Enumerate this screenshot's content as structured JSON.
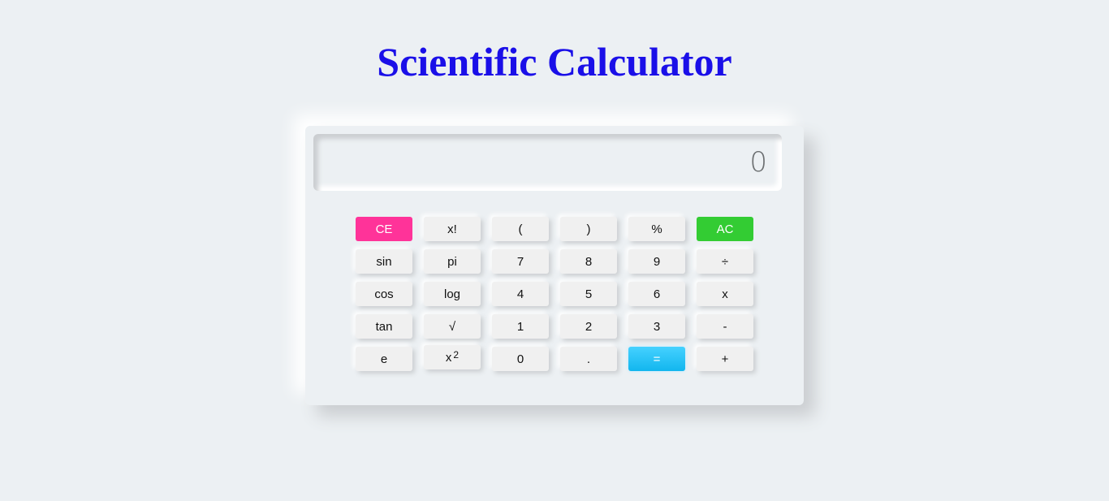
{
  "page": {
    "title": "Scientific Calculator"
  },
  "display": {
    "value": "0"
  },
  "colors": {
    "title": "#1a0fe8",
    "ce": "#ff3399",
    "ac": "#33cc33",
    "equals": "#1ec0f5",
    "background": "#ecf0f3"
  },
  "keys": {
    "ce": "CE",
    "factorial": "x!",
    "open_paren": "(",
    "close_paren": ")",
    "percent": "%",
    "ac": "AC",
    "sin": "sin",
    "pi": "pi",
    "seven": "7",
    "eight": "8",
    "nine": "9",
    "divide": "÷",
    "cos": "cos",
    "log": "log",
    "four": "4",
    "five": "5",
    "six": "6",
    "multiply": "x",
    "tan": "tan",
    "sqrt": "√",
    "one": "1",
    "two": "2",
    "three": "3",
    "minus": "-",
    "e": "e",
    "square_base": "x",
    "square_exp": "2",
    "zero": "0",
    "dot": ".",
    "equals": "=",
    "plus": "+"
  }
}
